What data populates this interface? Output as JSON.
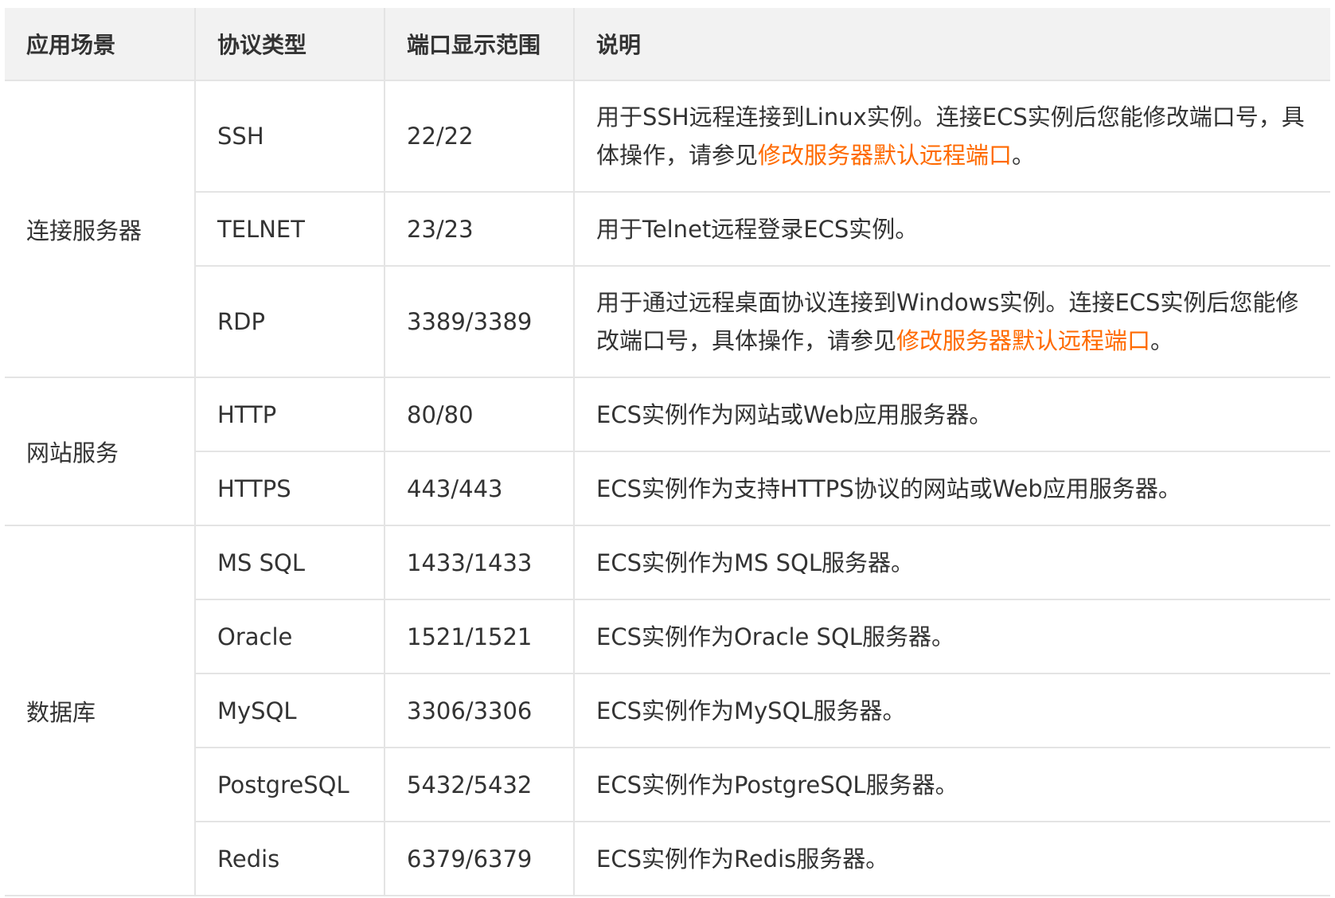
{
  "headers": {
    "scenario": "应用场景",
    "protocol": "协议类型",
    "port_range": "端口显示范围",
    "description": "说明"
  },
  "groups": [
    {
      "scenario": "连接服务器",
      "rows": [
        {
          "protocol": "SSH",
          "port": "22/22",
          "desc_before": "用于SSH远程连接到Linux实例。连接ECS实例后您能修改端口号，具体操作，请参见",
          "desc_link": "修改服务器默认远程端口",
          "desc_after": "。"
        },
        {
          "protocol": "TELNET",
          "port": "23/23",
          "desc_before": "用于Telnet远程登录ECS实例。",
          "desc_link": "",
          "desc_after": ""
        },
        {
          "protocol": "RDP",
          "port": "3389/3389",
          "desc_before": "用于通过远程桌面协议连接到Windows实例。连接ECS实例后您能修改端口号，具体操作，请参见",
          "desc_link": "修改服务器默认远程端口",
          "desc_after": "。"
        }
      ]
    },
    {
      "scenario": "网站服务",
      "rows": [
        {
          "protocol": "HTTP",
          "port": "80/80",
          "desc_before": "ECS实例作为网站或Web应用服务器。",
          "desc_link": "",
          "desc_after": ""
        },
        {
          "protocol": "HTTPS",
          "port": "443/443",
          "desc_before": "ECS实例作为支持HTTPS协议的网站或Web应用服务器。",
          "desc_link": "",
          "desc_after": ""
        }
      ]
    },
    {
      "scenario": "数据库",
      "rows": [
        {
          "protocol": "MS SQL",
          "port": "1433/1433",
          "desc_before": "ECS实例作为MS SQL服务器。",
          "desc_link": "",
          "desc_after": ""
        },
        {
          "protocol": "Oracle",
          "port": "1521/1521",
          "desc_before": "ECS实例作为Oracle SQL服务器。",
          "desc_link": "",
          "desc_after": ""
        },
        {
          "protocol": "MySQL",
          "port": "3306/3306",
          "desc_before": "ECS实例作为MySQL服务器。",
          "desc_link": "",
          "desc_after": ""
        },
        {
          "protocol": "PostgreSQL",
          "port": "5432/5432",
          "desc_before": "ECS实例作为PostgreSQL服务器。",
          "desc_link": "",
          "desc_after": ""
        },
        {
          "protocol": "Redis",
          "port": "6379/6379",
          "desc_before": "ECS实例作为Redis服务器。",
          "desc_link": "",
          "desc_after": ""
        }
      ]
    }
  ],
  "colors": {
    "link": "#ff6a00",
    "header_bg": "#f2f2f2",
    "border": "#e4e4e4",
    "text": "#333333"
  }
}
